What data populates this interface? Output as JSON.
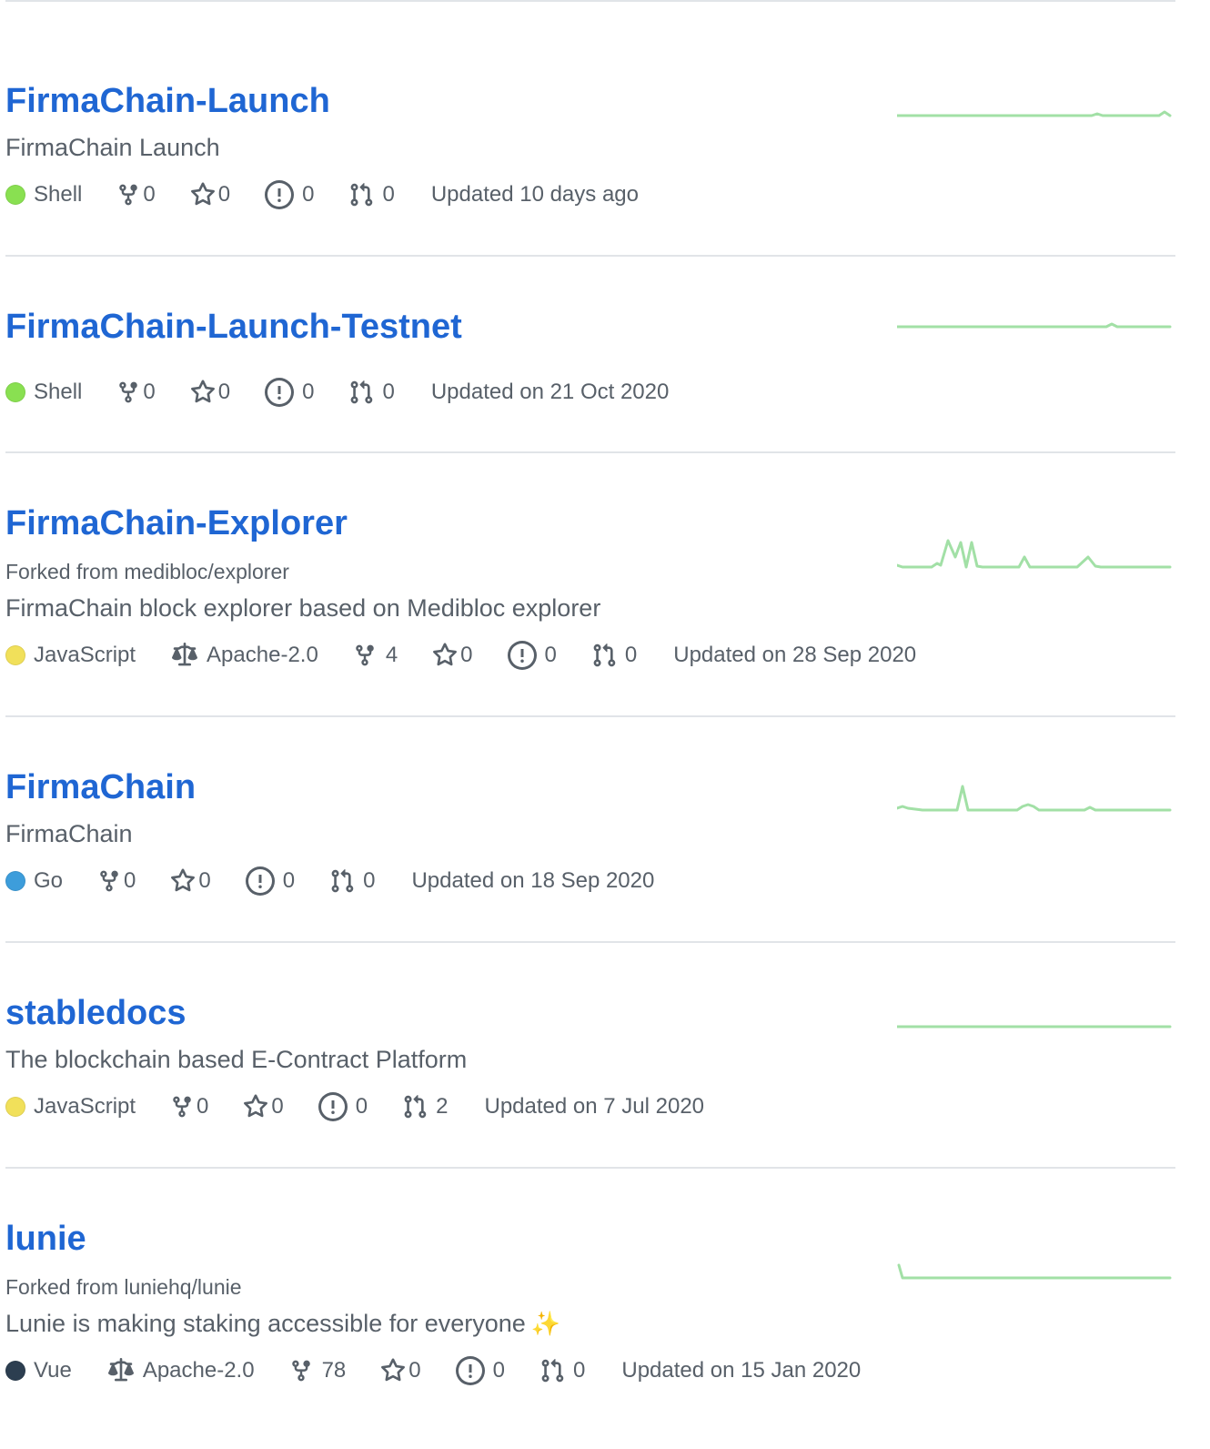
{
  "repos": [
    {
      "name": "FirmaChain-Launch",
      "forked_from": null,
      "description": "FirmaChain Launch",
      "language": "Shell",
      "language_color": "#89e051",
      "license": null,
      "forks": "0",
      "stars": "0",
      "issues": "0",
      "pulls": "0",
      "updated": "Updated 10 days ago"
    },
    {
      "name": "FirmaChain-Launch-Testnet",
      "forked_from": null,
      "description": null,
      "language": "Shell",
      "language_color": "#89e051",
      "license": null,
      "forks": "0",
      "stars": "0",
      "issues": "0",
      "pulls": "0",
      "updated": "Updated on 21 Oct 2020"
    },
    {
      "name": "FirmaChain-Explorer",
      "forked_from": "Forked from medibloc/explorer",
      "description": "FirmaChain block explorer based on Medibloc explorer",
      "language": "JavaScript",
      "language_color": "#f1e05a",
      "license": "Apache-2.0",
      "forks": "4",
      "stars": "0",
      "issues": "0",
      "pulls": "0",
      "updated": "Updated on 28 Sep 2020"
    },
    {
      "name": "FirmaChain",
      "forked_from": null,
      "description": "FirmaChain",
      "language": "Go",
      "language_color": "#00ADD8",
      "license": null,
      "forks": "0",
      "stars": "0",
      "issues": "0",
      "pulls": "0",
      "updated": "Updated on 18 Sep 2020"
    },
    {
      "name": "stabledocs",
      "forked_from": null,
      "description": "The blockchain based E-Contract Platform",
      "language": "JavaScript",
      "language_color": "#f1e05a",
      "license": null,
      "forks": "0",
      "stars": "0",
      "issues": "0",
      "pulls": "2",
      "updated": "Updated on 7 Jul 2020"
    },
    {
      "name": "lunie",
      "forked_from": "Forked from luniehq/lunie",
      "description": "Lunie is making staking accessible for everyone",
      "description_emoji": "✨",
      "language": "Vue",
      "language_color": "#2c3e50",
      "license": "Apache-2.0",
      "forks": "78",
      "stars": "0",
      "issues": "0",
      "pulls": "0",
      "updated": "Updated on 15 Jan 2020"
    }
  ],
  "icons": {
    "fork": "repo-forked-icon",
    "star": "star-icon",
    "issue": "issue-opened-icon",
    "pull": "git-pull-request-icon",
    "license": "law-icon"
  },
  "colors": {
    "link": "#1f66d3",
    "muted": "#586069",
    "border": "#e1e4e8",
    "sparkline": "#a2e0a6"
  }
}
